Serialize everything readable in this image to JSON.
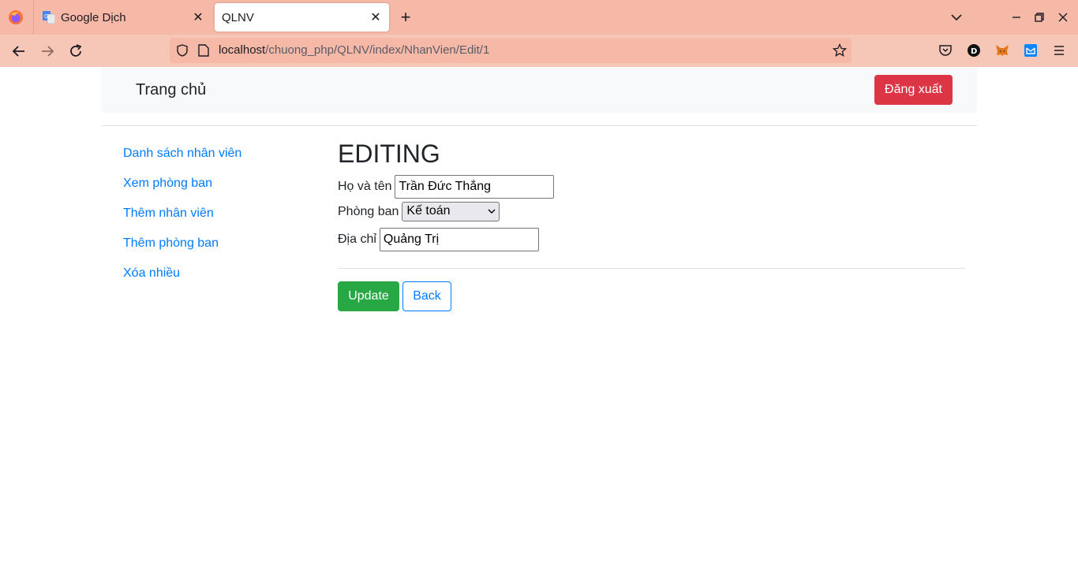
{
  "browser": {
    "tabs": [
      {
        "title": "Google Dịch",
        "active": false
      },
      {
        "title": "QLNV",
        "active": true
      }
    ],
    "url_host": "localhost",
    "url_path": "/chuong_php/QLNV/index/NhanVien/Edit/1",
    "colors": {
      "tabbar": "#f6b9a7",
      "toolbar": "#f6c6b6"
    }
  },
  "header": {
    "brand": "Trang chủ",
    "logout_label": "Đăng xuất"
  },
  "sidebar": {
    "items": [
      {
        "label": "Danh sách nhân viên"
      },
      {
        "label": "Xem phòng ban"
      },
      {
        "label": "Thêm nhân viên"
      },
      {
        "label": "Thêm phòng ban"
      },
      {
        "label": "Xóa nhiều"
      }
    ]
  },
  "form": {
    "heading": "EDITING",
    "name_label": "Họ và tên",
    "name_value": "Trần Đức Thắng",
    "dept_label": "Phòng ban",
    "dept_value": "Kế toán",
    "address_label": "Địa chỉ",
    "address_value": "Quảng Trị",
    "update_label": "Update",
    "back_label": "Back"
  }
}
